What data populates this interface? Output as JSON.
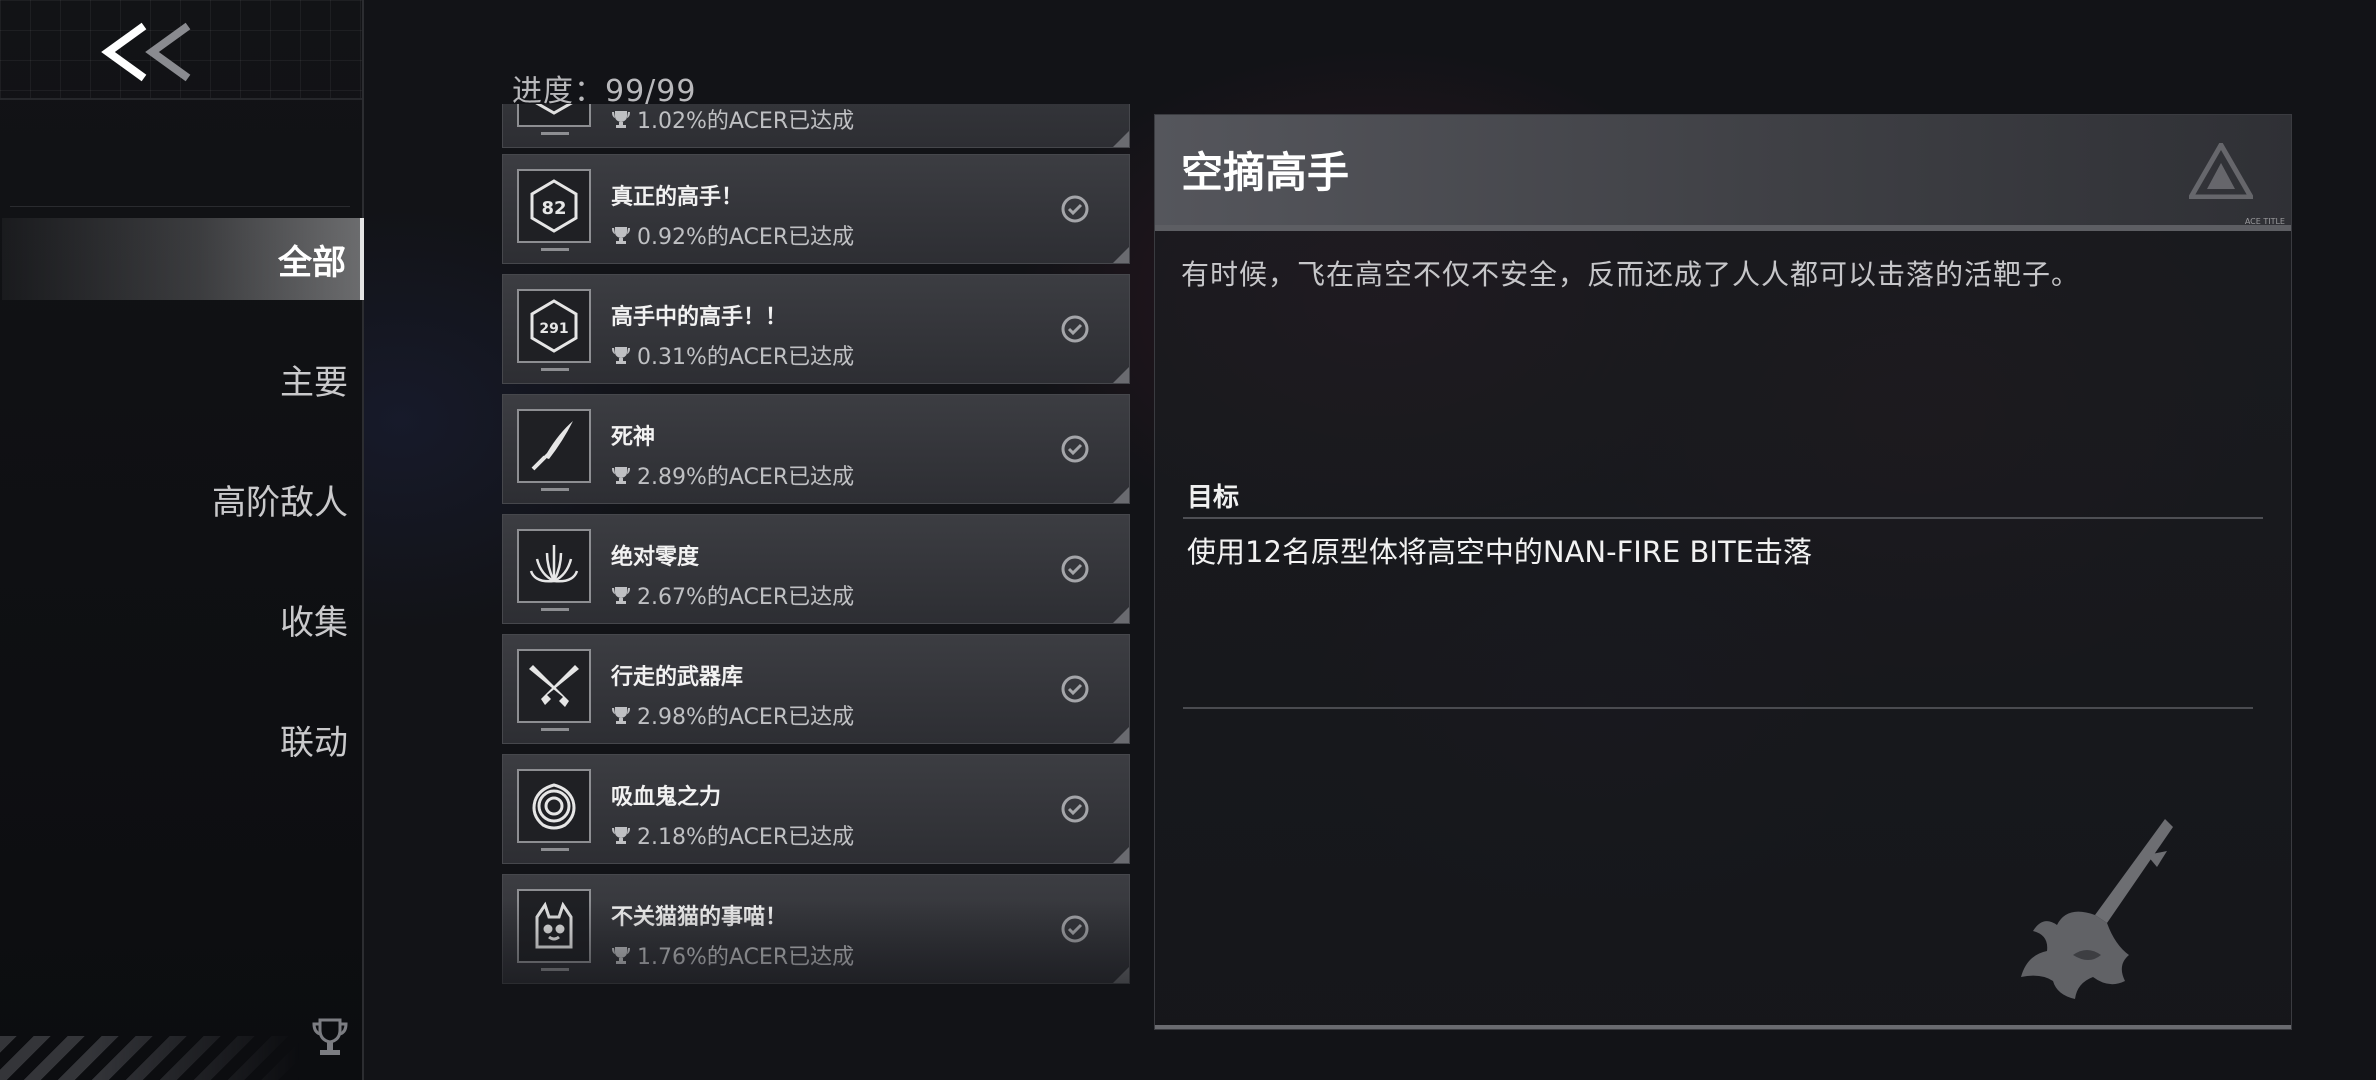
{
  "nav": {
    "back_label": "<<",
    "items": [
      {
        "label": "全部",
        "active": true
      },
      {
        "label": "主要",
        "active": false
      },
      {
        "label": "高阶敌人",
        "active": false
      },
      {
        "label": "收集",
        "active": false
      },
      {
        "label": "联动",
        "active": false
      }
    ]
  },
  "progress": {
    "label": "进度：99/99"
  },
  "achievements": [
    {
      "title": "",
      "stat": "1.02%的ACER已达成",
      "icon": "hexagon-badge-icon",
      "completed": true
    },
    {
      "title": "真正的高手！",
      "stat": "0.92%的ACER已达成",
      "icon": "hexagon-badge-82-icon",
      "badge_text": "82",
      "completed": true
    },
    {
      "title": "高手中的高手！！",
      "stat": "0.31%的ACER已达成",
      "icon": "hexagon-badge-291-icon",
      "badge_text": "291",
      "completed": true
    },
    {
      "title": "死神",
      "stat": "2.89%的ACER已达成",
      "icon": "scythe-blade-icon",
      "completed": true
    },
    {
      "title": "绝对零度",
      "stat": "2.67%的ACER已达成",
      "icon": "ice-crystal-icon",
      "completed": true
    },
    {
      "title": "行走的武器库",
      "stat": "2.98%的ACER已达成",
      "icon": "crossed-guns-icon",
      "completed": true
    },
    {
      "title": "吸血鬼之力",
      "stat": "2.18%的ACER已达成",
      "icon": "rose-icon",
      "completed": true
    },
    {
      "title": "不关猫猫的事喵！",
      "stat": "1.76%的ACER已达成",
      "icon": "cat-icon",
      "completed": true
    }
  ],
  "detail": {
    "title": "空摘高手",
    "tiny_text": "ACE TITLE",
    "description": "有时候，飞在高空不仅不安全，反而还成了人人都可以击落的活靶子。",
    "goal_label": "目标",
    "goal_text": "使用12名原型体将高空中的NAN-FIRE BITE击落"
  },
  "colors": {
    "background": "#121317",
    "card": "#35363b",
    "accent_text": "#ffffff",
    "muted_text": "#bfc0c3"
  }
}
